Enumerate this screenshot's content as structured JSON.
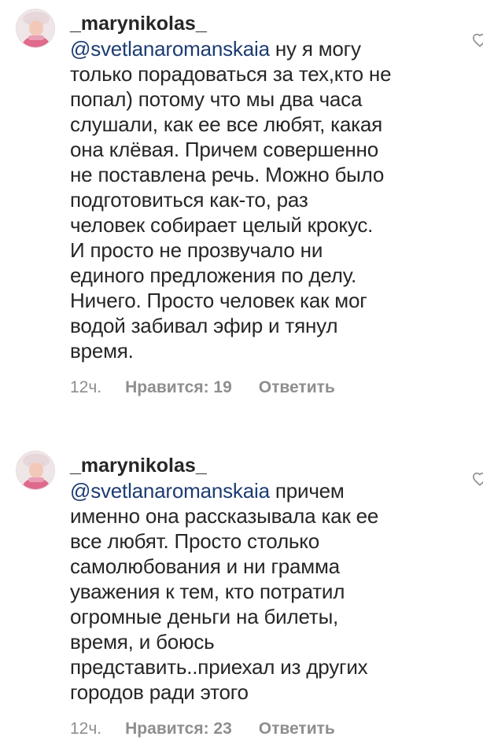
{
  "comments": [
    {
      "username": "_marynikolas_",
      "mention": "@svetlanaromanskaia",
      "lines": [
        " ну я могу",
        "только порадоваться за тех,кто не",
        "попал) потому что мы два часа",
        "слушали, как ее все любят, какая",
        "она клёвая. Причем совершенно",
        "не поставлена речь. Можно было",
        "подготовиться как-то, раз",
        "человек собирает целый крокус.",
        "И просто не прозвучало ни",
        "единого предложения по делу.",
        "Ничего. Просто человек как мог",
        "водой забивал эфир и тянул",
        "время."
      ],
      "time": "12ч.",
      "likes": "Нравится: 19",
      "reply": "Ответить"
    },
    {
      "username": "_marynikolas_",
      "mention": "@svetlanaromanskaia",
      "lines": [
        " причем",
        "именно она рассказывала как ее",
        "все любят. Просто столько",
        "самолюбования и ни грамма",
        "уважения к тем, кто потратил",
        "огромные деньги на билеты,",
        "время, и боюсь",
        "представить..приехал из других",
        "городов ради этого"
      ],
      "time": "12ч.",
      "likes": "Нравится: 23",
      "reply": "Ответить"
    }
  ],
  "icons": {
    "avatar": "profile-photo",
    "like": "heart-outline-icon"
  },
  "colors": {
    "text": "#262626",
    "mention": "#1d3c73",
    "meta": "#8e8e8e"
  }
}
